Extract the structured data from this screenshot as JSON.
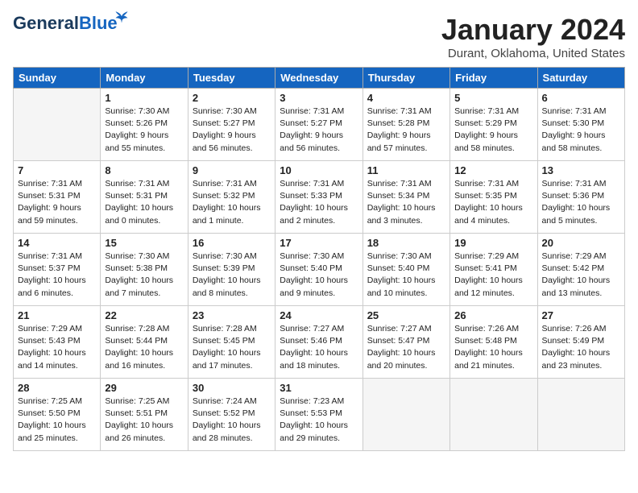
{
  "logo": {
    "part1": "General",
    "part2": "Blue"
  },
  "title": "January 2024",
  "location": "Durant, Oklahoma, United States",
  "days_of_week": [
    "Sunday",
    "Monday",
    "Tuesday",
    "Wednesday",
    "Thursday",
    "Friday",
    "Saturday"
  ],
  "weeks": [
    [
      {
        "day": "",
        "info": ""
      },
      {
        "day": "1",
        "info": "Sunrise: 7:30 AM\nSunset: 5:26 PM\nDaylight: 9 hours\nand 55 minutes."
      },
      {
        "day": "2",
        "info": "Sunrise: 7:30 AM\nSunset: 5:27 PM\nDaylight: 9 hours\nand 56 minutes."
      },
      {
        "day": "3",
        "info": "Sunrise: 7:31 AM\nSunset: 5:27 PM\nDaylight: 9 hours\nand 56 minutes."
      },
      {
        "day": "4",
        "info": "Sunrise: 7:31 AM\nSunset: 5:28 PM\nDaylight: 9 hours\nand 57 minutes."
      },
      {
        "day": "5",
        "info": "Sunrise: 7:31 AM\nSunset: 5:29 PM\nDaylight: 9 hours\nand 58 minutes."
      },
      {
        "day": "6",
        "info": "Sunrise: 7:31 AM\nSunset: 5:30 PM\nDaylight: 9 hours\nand 58 minutes."
      }
    ],
    [
      {
        "day": "7",
        "info": "Sunrise: 7:31 AM\nSunset: 5:31 PM\nDaylight: 9 hours\nand 59 minutes."
      },
      {
        "day": "8",
        "info": "Sunrise: 7:31 AM\nSunset: 5:31 PM\nDaylight: 10 hours\nand 0 minutes."
      },
      {
        "day": "9",
        "info": "Sunrise: 7:31 AM\nSunset: 5:32 PM\nDaylight: 10 hours\nand 1 minute."
      },
      {
        "day": "10",
        "info": "Sunrise: 7:31 AM\nSunset: 5:33 PM\nDaylight: 10 hours\nand 2 minutes."
      },
      {
        "day": "11",
        "info": "Sunrise: 7:31 AM\nSunset: 5:34 PM\nDaylight: 10 hours\nand 3 minutes."
      },
      {
        "day": "12",
        "info": "Sunrise: 7:31 AM\nSunset: 5:35 PM\nDaylight: 10 hours\nand 4 minutes."
      },
      {
        "day": "13",
        "info": "Sunrise: 7:31 AM\nSunset: 5:36 PM\nDaylight: 10 hours\nand 5 minutes."
      }
    ],
    [
      {
        "day": "14",
        "info": "Sunrise: 7:31 AM\nSunset: 5:37 PM\nDaylight: 10 hours\nand 6 minutes."
      },
      {
        "day": "15",
        "info": "Sunrise: 7:30 AM\nSunset: 5:38 PM\nDaylight: 10 hours\nand 7 minutes."
      },
      {
        "day": "16",
        "info": "Sunrise: 7:30 AM\nSunset: 5:39 PM\nDaylight: 10 hours\nand 8 minutes."
      },
      {
        "day": "17",
        "info": "Sunrise: 7:30 AM\nSunset: 5:40 PM\nDaylight: 10 hours\nand 9 minutes."
      },
      {
        "day": "18",
        "info": "Sunrise: 7:30 AM\nSunset: 5:40 PM\nDaylight: 10 hours\nand 10 minutes."
      },
      {
        "day": "19",
        "info": "Sunrise: 7:29 AM\nSunset: 5:41 PM\nDaylight: 10 hours\nand 12 minutes."
      },
      {
        "day": "20",
        "info": "Sunrise: 7:29 AM\nSunset: 5:42 PM\nDaylight: 10 hours\nand 13 minutes."
      }
    ],
    [
      {
        "day": "21",
        "info": "Sunrise: 7:29 AM\nSunset: 5:43 PM\nDaylight: 10 hours\nand 14 minutes."
      },
      {
        "day": "22",
        "info": "Sunrise: 7:28 AM\nSunset: 5:44 PM\nDaylight: 10 hours\nand 16 minutes."
      },
      {
        "day": "23",
        "info": "Sunrise: 7:28 AM\nSunset: 5:45 PM\nDaylight: 10 hours\nand 17 minutes."
      },
      {
        "day": "24",
        "info": "Sunrise: 7:27 AM\nSunset: 5:46 PM\nDaylight: 10 hours\nand 18 minutes."
      },
      {
        "day": "25",
        "info": "Sunrise: 7:27 AM\nSunset: 5:47 PM\nDaylight: 10 hours\nand 20 minutes."
      },
      {
        "day": "26",
        "info": "Sunrise: 7:26 AM\nSunset: 5:48 PM\nDaylight: 10 hours\nand 21 minutes."
      },
      {
        "day": "27",
        "info": "Sunrise: 7:26 AM\nSunset: 5:49 PM\nDaylight: 10 hours\nand 23 minutes."
      }
    ],
    [
      {
        "day": "28",
        "info": "Sunrise: 7:25 AM\nSunset: 5:50 PM\nDaylight: 10 hours\nand 25 minutes."
      },
      {
        "day": "29",
        "info": "Sunrise: 7:25 AM\nSunset: 5:51 PM\nDaylight: 10 hours\nand 26 minutes."
      },
      {
        "day": "30",
        "info": "Sunrise: 7:24 AM\nSunset: 5:52 PM\nDaylight: 10 hours\nand 28 minutes."
      },
      {
        "day": "31",
        "info": "Sunrise: 7:23 AM\nSunset: 5:53 PM\nDaylight: 10 hours\nand 29 minutes."
      },
      {
        "day": "",
        "info": ""
      },
      {
        "day": "",
        "info": ""
      },
      {
        "day": "",
        "info": ""
      }
    ]
  ]
}
